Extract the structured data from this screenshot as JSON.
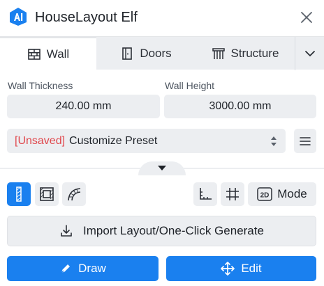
{
  "app": {
    "title": "HouseLayout Elf",
    "logo_icon": "house-logo-icon",
    "accent_color": "#1a80ef"
  },
  "tabs": [
    {
      "label": "Wall",
      "icon": "brick-wall-icon",
      "active": true
    },
    {
      "label": "Doors",
      "icon": "door-icon",
      "active": false
    },
    {
      "label": "Structure",
      "icon": "structure-icon",
      "active": false
    }
  ],
  "fields": {
    "thickness": {
      "label": "Wall Thickness",
      "value": "240.00 mm"
    },
    "height": {
      "label": "Wall Height",
      "value": "3000.00 mm"
    }
  },
  "preset": {
    "unsaved": "[Unsaved]",
    "name": "Customize Preset",
    "unsaved_color": "#e0474c"
  },
  "mode": {
    "label": "Mode",
    "badge": "2D"
  },
  "actions": {
    "import": "Import Layout/One-Click Generate",
    "draw": "Draw",
    "edit": "Edit"
  }
}
